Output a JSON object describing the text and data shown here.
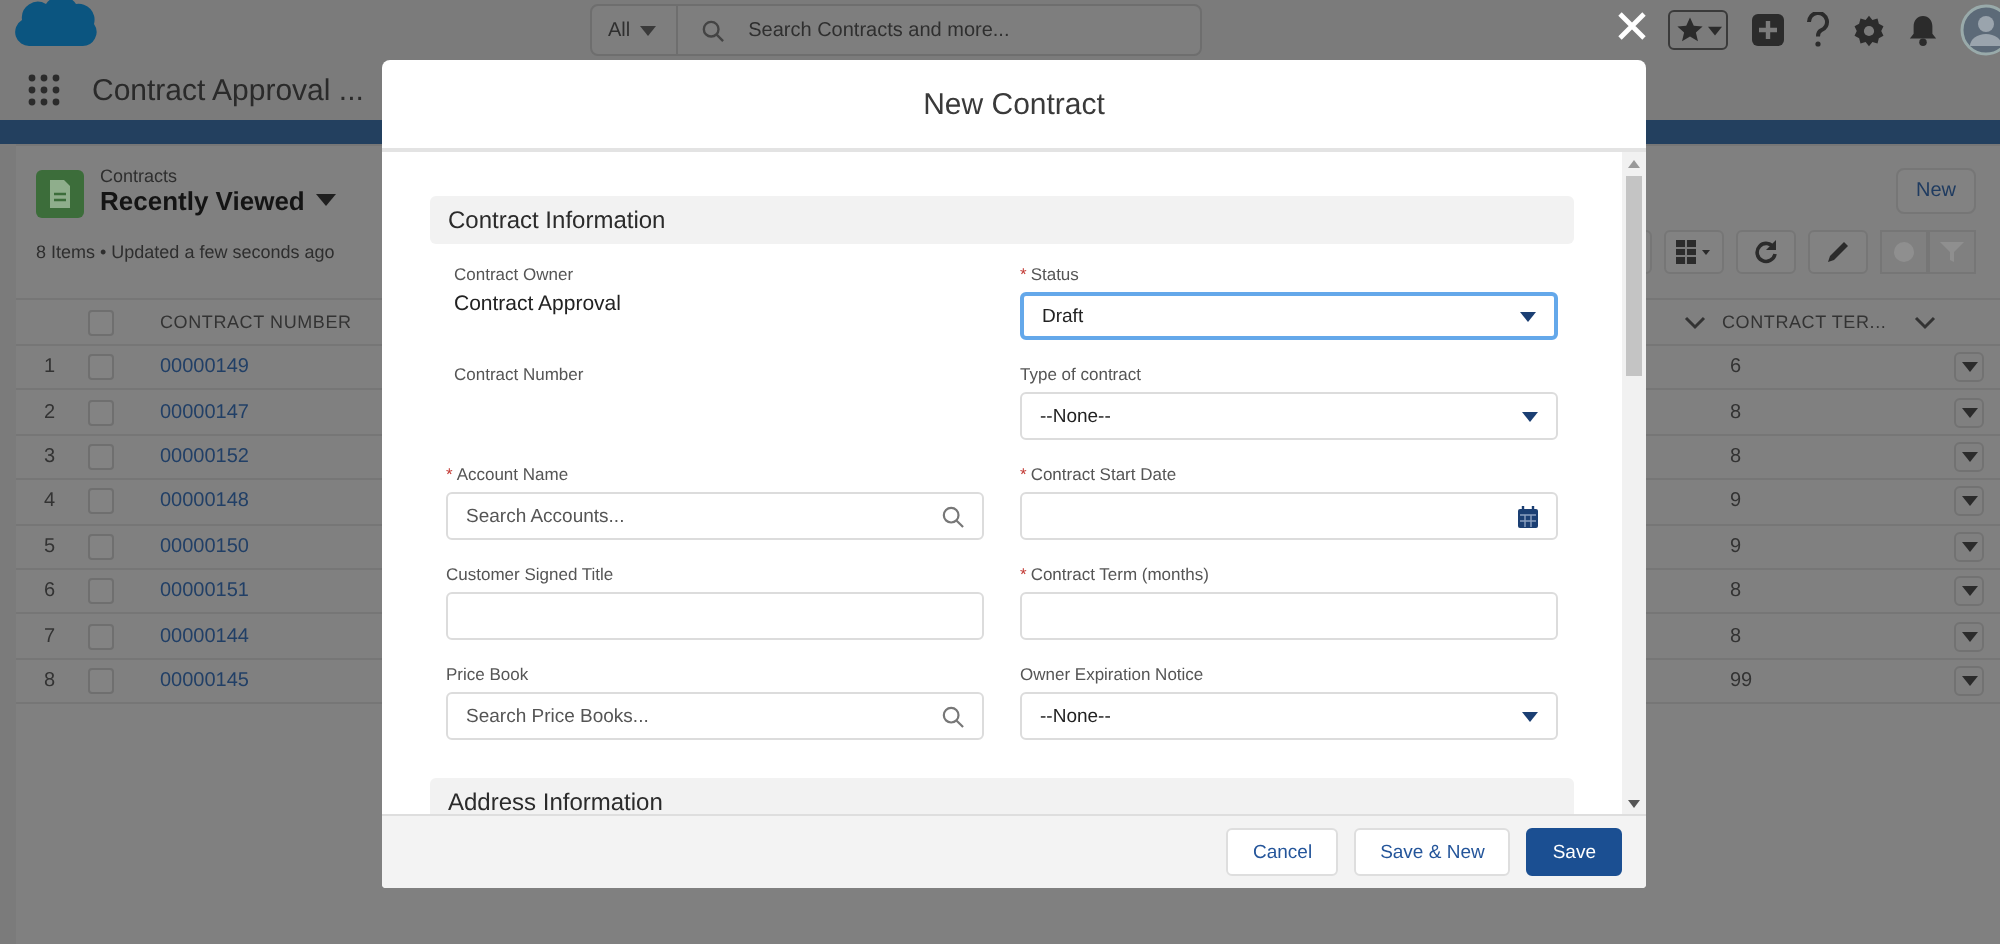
{
  "header": {
    "search_scope": "All",
    "search_placeholder": "Search Contracts and more..."
  },
  "nav": {
    "app_name": "Contract Approval ..."
  },
  "list_view": {
    "object": "Contracts",
    "title": "Recently Viewed",
    "status": "8 Items • Updated a few seconds ago",
    "new_button": "New"
  },
  "table": {
    "select_all_checked": false,
    "columns": [
      "CONTRACT NUMBER",
      "CONTRACT TER..."
    ],
    "rows": [
      {
        "row_number": "1",
        "contract_number": "00000149",
        "contract_term": "6",
        "checked": false
      },
      {
        "row_number": "2",
        "contract_number": "00000147",
        "contract_term": "8",
        "checked": false
      },
      {
        "row_number": "3",
        "contract_number": "00000152",
        "contract_term": "8",
        "checked": false
      },
      {
        "row_number": "4",
        "contract_number": "00000148",
        "contract_term": "9",
        "checked": false
      },
      {
        "row_number": "5",
        "contract_number": "00000150",
        "contract_term": "9",
        "checked": false
      },
      {
        "row_number": "6",
        "contract_number": "00000151",
        "contract_term": "8",
        "checked": false
      },
      {
        "row_number": "7",
        "contract_number": "00000144",
        "contract_term": "8",
        "checked": false
      },
      {
        "row_number": "8",
        "contract_number": "00000145",
        "contract_term": "99",
        "checked": false
      }
    ]
  },
  "modal": {
    "title": "New Contract",
    "sections": [
      {
        "title": "Contract Information",
        "fields": [
          {
            "label": "Contract Owner",
            "kind": "readonly",
            "value": "Contract Approval"
          },
          {
            "required_marker": "*",
            "label": "Status",
            "kind": "picklist",
            "focused": true,
            "value": "Draft"
          },
          {
            "label": "Contract Number",
            "kind": "readonly"
          },
          {
            "label": "Type of contract",
            "kind": "picklist",
            "focused": false,
            "value": "--None--"
          },
          {
            "required_marker": "*",
            "label": "Account Name",
            "kind": "lookup",
            "placeholder": "Search Accounts..."
          },
          {
            "required_marker": "*",
            "label": "Contract Start Date",
            "kind": "date"
          },
          {
            "label": "Customer Signed Title",
            "kind": "text"
          },
          {
            "required_marker": "*",
            "label": "Contract Term (months)",
            "kind": "text"
          },
          {
            "label": "Price Book",
            "kind": "lookup",
            "placeholder": "Search Price Books..."
          },
          {
            "label": "Owner Expiration Notice",
            "kind": "picklist",
            "focused": false,
            "value": "--None--"
          }
        ]
      },
      {
        "title": "Address Information"
      }
    ],
    "buttons": [
      {
        "label": "Cancel",
        "kind": "secondary"
      },
      {
        "label": "Save & New",
        "kind": "secondary"
      },
      {
        "label": "Save",
        "kind": "primary"
      }
    ]
  }
}
